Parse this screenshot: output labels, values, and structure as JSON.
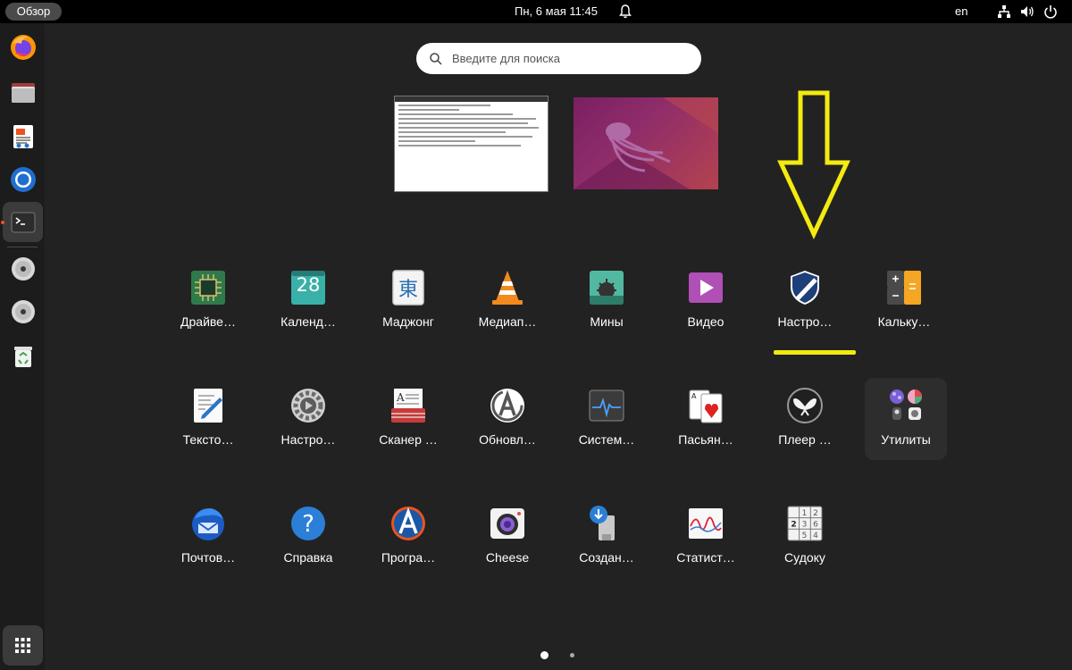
{
  "topbar": {
    "overview_label": "Обзор",
    "clock": "Пн, 6 мая  11:45",
    "lang": "en",
    "icons": [
      "bell-icon",
      "network-icon",
      "volume-icon",
      "power-icon"
    ]
  },
  "dock": {
    "items": [
      "firefox-icon",
      "files-icon",
      "text-editor-icon",
      "chromium-icon",
      "terminal-icon",
      "disc-icon",
      "disc-icon",
      "trash-icon"
    ],
    "apps_button": "show-apps-icon"
  },
  "search": {
    "placeholder": "Введите для поиска"
  },
  "apps": {
    "row1": [
      "Драйве…",
      "Календ…",
      "Маджонг",
      "Медиап…",
      "Мины",
      "Видео",
      "Настро…",
      "Кальку…"
    ],
    "row2": [
      "Тексто…",
      "Настро…",
      "Сканер …",
      "Обновл…",
      "Систем…",
      "Пасьян…",
      "Плеер …",
      "Утилиты"
    ],
    "row3": [
      "Почтов…",
      "Справка",
      "Програ…",
      "Cheese",
      "Создан…",
      "Статист…",
      "Судоку"
    ],
    "calendar_day": "28",
    "mahjong_glyph": "東"
  },
  "annotation": {
    "color": "#f3ea10"
  },
  "pager": {
    "pages": 2,
    "current": 1
  }
}
